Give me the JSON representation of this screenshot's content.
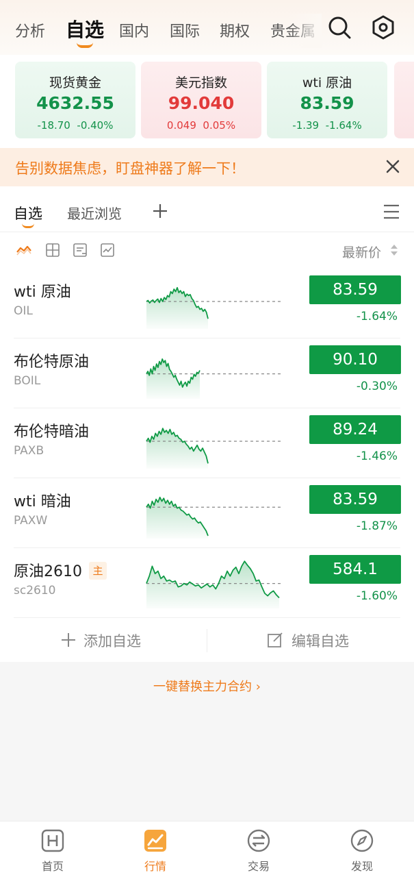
{
  "top_tabs": [
    {
      "label": "分析",
      "active": false
    },
    {
      "label": "自选",
      "active": true
    },
    {
      "label": "国内",
      "active": false
    },
    {
      "label": "国际",
      "active": false
    },
    {
      "label": "期权",
      "active": false
    },
    {
      "label": "贵金属",
      "active": false
    }
  ],
  "header_icons": [
    "search-icon",
    "settings-icon"
  ],
  "quote_cards": [
    {
      "name": "现货黄金",
      "price": "4632.55",
      "change": "-18.70",
      "percent": "-0.40%",
      "trend": "down"
    },
    {
      "name": "美元指数",
      "price": "99.040",
      "change": "0.049",
      "percent": "0.05%",
      "trend": "up"
    },
    {
      "name": "wti 原油",
      "price": "83.59",
      "change": "-1.39",
      "percent": "-1.64%",
      "trend": "down"
    }
  ],
  "banner": {
    "text": "告别数据焦虑，盯盘神器了解一下！"
  },
  "sub_tabs": {
    "watchlist": "自选",
    "recent": "最近浏览"
  },
  "view_toolbar": {
    "icons": [
      "sparkline-view-icon",
      "grid-view-icon",
      "detail-view-icon",
      "chart-view-icon"
    ],
    "sort_label": "最新价"
  },
  "watchlist": [
    {
      "name": "wti 原油",
      "code": "OIL",
      "price": "83.59",
      "percent": "-1.64%",
      "badge": null,
      "spark": [
        0.5,
        0.48,
        0.53,
        0.49,
        0.47,
        0.52,
        0.48,
        0.45,
        0.52,
        0.44,
        0.5,
        0.42,
        0.46,
        0.38,
        0.41,
        0.3,
        0.34,
        0.25,
        0.3,
        0.22,
        0.32,
        0.28,
        0.34,
        0.3,
        0.4,
        0.35,
        0.38,
        0.36,
        0.44,
        0.48,
        0.56,
        0.62,
        0.6,
        0.66,
        0.64,
        0.7,
        0.66,
        0.72,
        0.85
      ]
    },
    {
      "name": "布伦特原油",
      "code": "BOIL",
      "price": "90.10",
      "percent": "-0.30%",
      "badge": null,
      "spark": [
        0.55,
        0.5,
        0.58,
        0.45,
        0.55,
        0.4,
        0.48,
        0.35,
        0.42,
        0.3,
        0.36,
        0.25,
        0.32,
        0.28,
        0.4,
        0.34,
        0.46,
        0.5,
        0.56,
        0.62,
        0.58,
        0.66,
        0.72,
        0.78,
        0.7,
        0.82,
        0.76,
        0.72,
        0.8,
        0.7,
        0.74,
        0.62,
        0.66,
        0.56,
        0.6,
        0.52,
        0.54,
        0.48
      ]
    },
    {
      "name": "布伦特暗油",
      "code": "PAXB",
      "price": "89.24",
      "percent": "-1.46%",
      "badge": null,
      "spark": [
        0.5,
        0.44,
        0.52,
        0.4,
        0.46,
        0.34,
        0.4,
        0.3,
        0.36,
        0.24,
        0.32,
        0.28,
        0.34,
        0.26,
        0.36,
        0.32,
        0.4,
        0.38,
        0.44,
        0.46,
        0.52,
        0.5,
        0.56,
        0.6,
        0.66,
        0.62,
        0.7,
        0.64,
        0.58,
        0.66,
        0.7,
        0.64,
        0.72,
        0.8,
        0.95
      ]
    },
    {
      "name": "wti 暗油",
      "code": "PAXW",
      "price": "83.59",
      "percent": "-1.87%",
      "badge": null,
      "spark": [
        0.42,
        0.36,
        0.44,
        0.3,
        0.38,
        0.26,
        0.32,
        0.22,
        0.3,
        0.24,
        0.34,
        0.28,
        0.36,
        0.3,
        0.4,
        0.36,
        0.44,
        0.42,
        0.48,
        0.5,
        0.54,
        0.58,
        0.56,
        0.62,
        0.66,
        0.64,
        0.7,
        0.74,
        0.72,
        0.78,
        0.84,
        0.9,
        1.0
      ]
    },
    {
      "name": "原油2610",
      "code": "sc2610",
      "price": "584.1",
      "percent": "-1.60%",
      "badge": "主",
      "spark": [
        0.55,
        0.4,
        0.2,
        0.35,
        0.3,
        0.45,
        0.4,
        0.5,
        0.48,
        0.52,
        0.5,
        0.62,
        0.6,
        0.55,
        0.58,
        0.52,
        0.56,
        0.6,
        0.58,
        0.64,
        0.6,
        0.56,
        0.62,
        0.58,
        0.66,
        0.55,
        0.4,
        0.45,
        0.3,
        0.4,
        0.28,
        0.22,
        0.35,
        0.2,
        0.1,
        0.18,
        0.25,
        0.35,
        0.5,
        0.48,
        0.62,
        0.75,
        0.8,
        0.74,
        0.7,
        0.78,
        0.84
      ]
    }
  ],
  "actions": {
    "add_label": "添加自选",
    "edit_label": "编辑自选"
  },
  "switch_link": "一键替换主力合约 ›",
  "bottom_nav": [
    {
      "label": "首页",
      "icon": "home-icon",
      "active": false
    },
    {
      "label": "行情",
      "icon": "market-icon",
      "active": true
    },
    {
      "label": "交易",
      "icon": "trade-icon",
      "active": false
    },
    {
      "label": "发现",
      "icon": "discover-icon",
      "active": false
    }
  ],
  "colors": {
    "accent": "#ee7a1a",
    "down_green": "#0f9a45",
    "up_red": "#e23a3a",
    "banner_bg": "#fdeee2"
  }
}
